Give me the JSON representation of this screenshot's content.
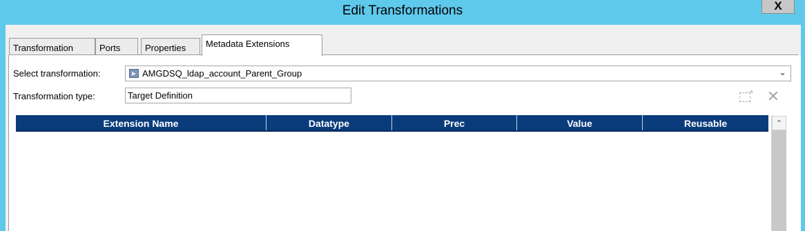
{
  "window": {
    "title": "Edit Transformations",
    "close_label": "X"
  },
  "tabs": [
    {
      "label": "Transformation"
    },
    {
      "label": "Ports"
    },
    {
      "label": "Properties"
    },
    {
      "label": "Metadata Extensions",
      "active": true
    }
  ],
  "form": {
    "select_label": "Select transformation:",
    "select_value": "AMGDSQ_ldap_account_Parent_Group",
    "type_label": "Transformation type:",
    "type_value": "Target Definition"
  },
  "toolbar": {
    "new_icon": "new-row-icon",
    "delete_icon": "delete-icon"
  },
  "grid": {
    "columns": [
      "Extension Name",
      "Datatype",
      "Prec",
      "Value",
      "Reusable"
    ],
    "rows": []
  },
  "colors": {
    "titlebar": "#5fc9ec",
    "grid_header": "#0a3c7c"
  }
}
